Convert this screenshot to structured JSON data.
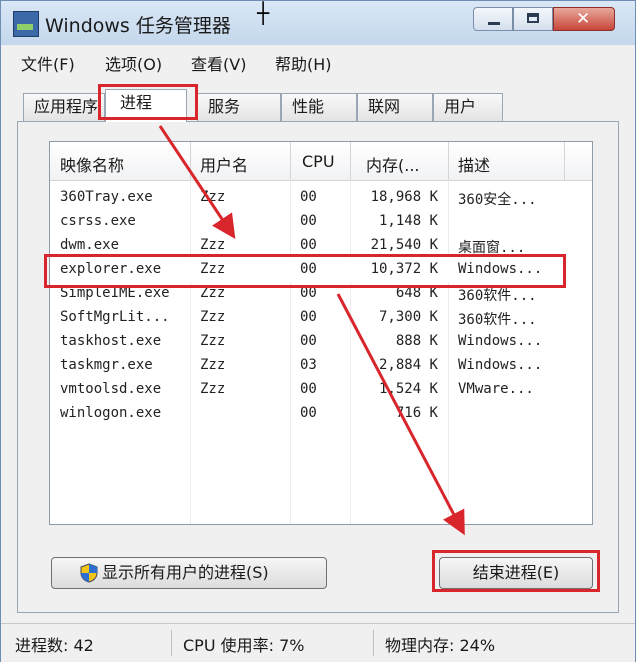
{
  "window": {
    "title": "Windows 任务管理器",
    "cursor_glyph": "┼"
  },
  "menu": [
    {
      "label": "文件(F)"
    },
    {
      "label": "选项(O)"
    },
    {
      "label": "查看(V)"
    },
    {
      "label": "帮助(H)"
    }
  ],
  "tabs": [
    {
      "label": "应用程序"
    },
    {
      "label": "进程",
      "active": true
    },
    {
      "label": "服务"
    },
    {
      "label": "性能"
    },
    {
      "label": "联网"
    },
    {
      "label": "用户"
    }
  ],
  "process_table": {
    "columns": [
      "映像名称",
      "用户名",
      "CPU",
      "内存(...",
      "描述"
    ],
    "rows": [
      {
        "name": "360Tray.exe",
        "user": "Zzz",
        "cpu": "00",
        "mem": "18,968 K",
        "desc": "360安全..."
      },
      {
        "name": "csrss.exe",
        "user": "",
        "cpu": "00",
        "mem": "1,148 K",
        "desc": ""
      },
      {
        "name": "dwm.exe",
        "user": "Zzz",
        "cpu": "00",
        "mem": "21,540 K",
        "desc": "桌面窗..."
      },
      {
        "name": "explorer.exe",
        "user": "Zzz",
        "cpu": "00",
        "mem": "10,372 K",
        "desc": "Windows..."
      },
      {
        "name": "SimpleIME.exe",
        "user": "Zzz",
        "cpu": "00",
        "mem": "648 K",
        "desc": "360软件..."
      },
      {
        "name": "SoftMgrLit...",
        "user": "Zzz",
        "cpu": "00",
        "mem": "7,300 K",
        "desc": "360软件..."
      },
      {
        "name": "taskhost.exe",
        "user": "Zzz",
        "cpu": "00",
        "mem": "888 K",
        "desc": "Windows..."
      },
      {
        "name": "taskmgr.exe",
        "user": "Zzz",
        "cpu": "03",
        "mem": "2,884 K",
        "desc": "Windows..."
      },
      {
        "name": "vmtoolsd.exe",
        "user": "Zzz",
        "cpu": "00",
        "mem": "1,524 K",
        "desc": "VMware..."
      },
      {
        "name": "winlogon.exe",
        "user": "",
        "cpu": "00",
        "mem": "716 K",
        "desc": ""
      }
    ],
    "highlighted_row": "explorer.exe"
  },
  "buttons": {
    "show_all": "显示所有用户的进程(S)",
    "end_process": "结束进程(E)"
  },
  "status": {
    "processes": "进程数: 42",
    "cpu": "CPU 使用率: 7%",
    "memory": "物理内存: 24%"
  },
  "colors": {
    "annotation_red": "#d8262c"
  }
}
